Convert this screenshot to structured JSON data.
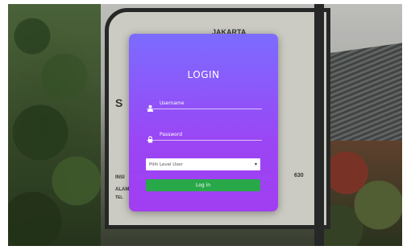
{
  "sign": {
    "top_text": "JAKARTA",
    "left_letter": "S",
    "left_text1": "INSI",
    "left_text2": "ALAMA",
    "left_text3": "TEL",
    "right_text": "630"
  },
  "login": {
    "title": "LOGIN",
    "username_placeholder": "Username",
    "password_placeholder": "Password",
    "level_select": "Pilih Level User",
    "submit_label": "Log in",
    "submit_color": "#29a84a",
    "gradient_top": "#7c6cff",
    "gradient_bottom": "#a13ef1"
  },
  "icons": {
    "username": "user-icon",
    "password": "lock-icon",
    "select": "chevron-down-icon"
  }
}
